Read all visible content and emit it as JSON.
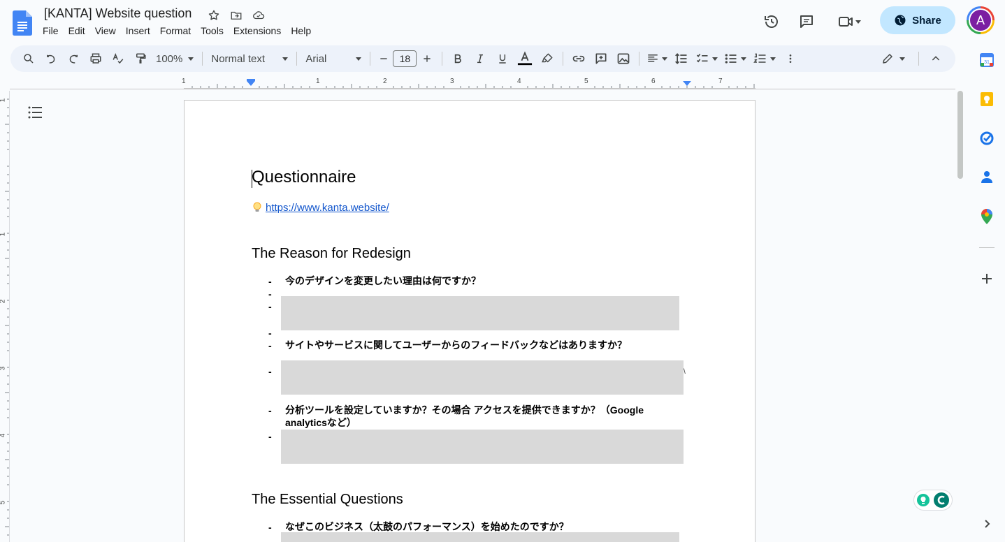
{
  "header": {
    "title": "[KANTA] Website question",
    "menu": [
      "File",
      "Edit",
      "View",
      "Insert",
      "Format",
      "Tools",
      "Extensions",
      "Help"
    ],
    "share_label": "Share",
    "avatar_letter": "A"
  },
  "toolbar": {
    "zoom": "100%",
    "style": "Normal text",
    "font": "Arial",
    "font_size": "18"
  },
  "ruler": {
    "labels": [
      "1",
      "1",
      "2",
      "3",
      "4",
      "5",
      "6",
      "7"
    ]
  },
  "vruler": {
    "labels": [
      "1",
      "1",
      "2",
      "3",
      "4",
      "5"
    ]
  },
  "document": {
    "title": "Questionnaire",
    "link": "https://www.kanta.website/",
    "sections": [
      {
        "heading": "The Reason for Redesign",
        "questions": [
          "今のデザインを変更したい理由は何ですか？",
          "サイトやサービスに関してユーザーからのフィードバックなどはありますか？",
          "分析ツールを設定していますか？その場合 アクセスを提供できますか？（Google analyticsなど）"
        ]
      },
      {
        "heading": "The Essential Questions",
        "questions": [
          "なぜこのビジネス（太鼓のパフォーマンス）を始めたのですか？"
        ]
      }
    ]
  },
  "colors": {
    "accent": "#c2e7ff",
    "link": "#1155cc",
    "redaction": "#d9d9d9",
    "avatar": "#7b1fa2"
  }
}
